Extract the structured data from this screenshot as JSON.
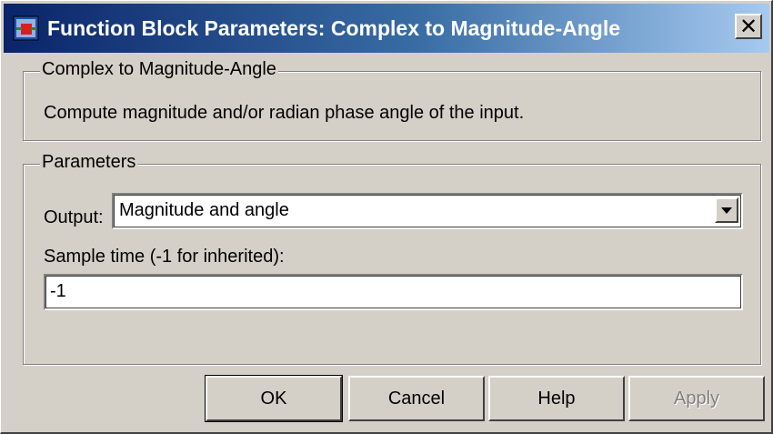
{
  "window": {
    "title": "Function Block Parameters: Complex to Magnitude-Angle",
    "close_glyph": "✕",
    "titlebar_colors": [
      "#0a246a",
      "#a6caf0"
    ]
  },
  "block_group": {
    "legend": "Complex to Magnitude-Angle",
    "description": "Compute magnitude and/or radian phase angle of the input."
  },
  "parameters_group": {
    "legend": "Parameters",
    "output_label": "Output:",
    "output_value": "Magnitude and angle",
    "sample_time_label": "Sample time (-1 for inherited):",
    "sample_time_value": "-1"
  },
  "buttons": {
    "ok": "OK",
    "cancel": "Cancel",
    "help": "Help",
    "apply": "Apply"
  }
}
